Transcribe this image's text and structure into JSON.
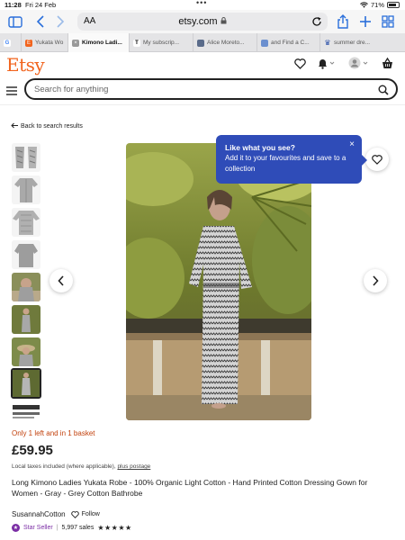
{
  "status_bar": {
    "time": "11:28",
    "date": "Fri 24 Feb",
    "battery": "71%"
  },
  "browser": {
    "text_size_label": "AA",
    "url": "etsy.com",
    "tabs": [
      {
        "favicon": "google-icon",
        "label": "G",
        "active": false
      },
      {
        "favicon": "etsy-icon",
        "label": "Yukata Wo",
        "active": false
      },
      {
        "favicon": "etsy-icon",
        "label": "Kimono Ladi...",
        "active": true
      },
      {
        "favicon": "t-icon",
        "label": "My subscrip...",
        "active": false
      },
      {
        "favicon": "image-icon",
        "label": "Alice Moreto...",
        "active": false
      },
      {
        "favicon": "picture-icon",
        "label": "and Find a C...",
        "active": false
      },
      {
        "favicon": "crown-icon",
        "label": "summer dre...",
        "active": false
      }
    ]
  },
  "etsy": {
    "logo": "Etsy",
    "search_placeholder": "Search for anything",
    "back_link": "Back to search results",
    "tooltip": {
      "title": "Like what you see?",
      "body": "Add it to your favourites and save to a collection",
      "close": "×"
    },
    "stock_note": "Only 1 left and in 1 basket",
    "price": "£59.95",
    "tax_note": "Local taxes included (where applicable),",
    "postage_link": "plus postage",
    "title": "Long Kimono Ladies Yukata Robe - 100% Organic Light Cotton - Hand Printed Cotton Dressing Gown for Women - Gray - Grey Cotton Bathrobe",
    "shop_name": "SusannahCotton",
    "follow_label": "Follow",
    "star_seller": "Star Seller",
    "sales": "5,997 sales",
    "rating_stars": "★★★★★"
  },
  "colors": {
    "etsy_orange": "#f1641e",
    "tooltip_blue": "#2f4cb8",
    "stock_red": "#c2410c",
    "star_seller_purple": "#7b2ea5",
    "safari_blue": "#2a6fdb"
  }
}
